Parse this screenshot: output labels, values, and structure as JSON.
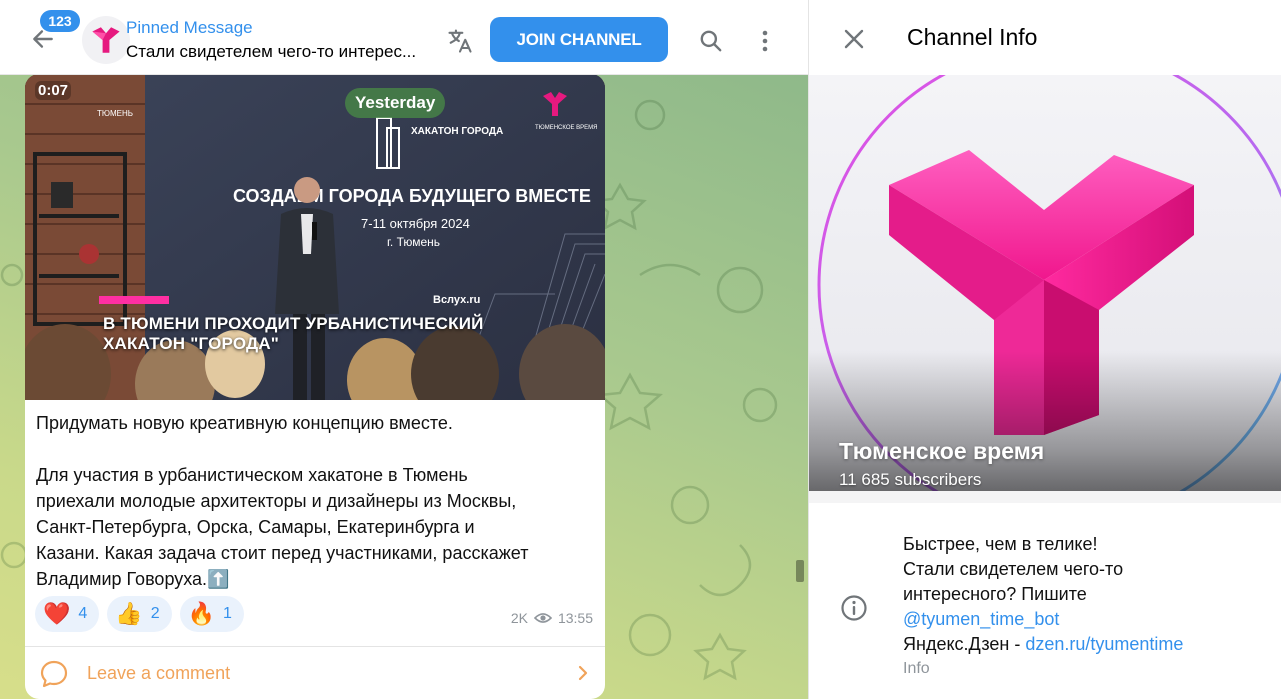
{
  "header": {
    "unread_count": "123",
    "pinned_title": "Pinned Message",
    "pinned_text": "Стали свидетелем чего-то интерес...",
    "join_label": "JOIN CHANNEL"
  },
  "message": {
    "duration": "0:07",
    "date_pill": "Yesterday",
    "media_caption_line1": "В ТЮМЕНИ ПРОХОДИТ УРБАНИСТИЧЕСКИЙ",
    "media_caption_line2": "ХАКАТОН \"ГОРОДА\"",
    "banner": {
      "city": "ТЮМЕНЬ",
      "hackathon": "ХАКАТОН ГОРОДА",
      "headline": "СОЗДАЕМ ГОРОДА БУДУЩЕГО ВМЕСТЕ",
      "dates": "7-11 октября 2024",
      "place": "г. Тюмень",
      "brand": "ТЮМЕНСКОЕ ВРЕМЯ",
      "sponsor": "Вслух.ru"
    },
    "bold_line": "Придумать новую креативную концепцию вместе.",
    "body_lines": [
      "Для участия в урбанистическом хакатоне в Тюмень",
      "приехали молодые архитекторы и дизайнеры из Москвы,",
      "Санкт-Петербурга, Орска, Самары, Екатеринбурга и",
      "Казани. Какая задача стоит перед участниками, расскажет",
      "Владимир Говоруха.⬆️"
    ],
    "reactions": [
      {
        "emoji": "❤️",
        "count": "4"
      },
      {
        "emoji": "👍",
        "count": "2"
      },
      {
        "emoji": "🔥",
        "count": "1"
      }
    ],
    "views": "2K",
    "time": "13:55",
    "comment_label": "Leave a comment"
  },
  "info": {
    "title": "Channel Info",
    "channel_name": "Тюменское время",
    "subscribers": "11 685 subscribers",
    "about_lines": [
      "Быстрее, чем в телике!",
      "Стали свидетелем чего-то",
      "интересного? Пишите"
    ],
    "bot_link": "@tyumen_time_bot",
    "dzen_prefix": "Яндекс.Дзен - ",
    "dzen_link": "dzen.ru/tyumentime",
    "about_label": "Info"
  },
  "colors": {
    "accent": "#3390ec",
    "comment_accent": "#f0a35a",
    "brand_magenta": "#e6197f"
  },
  "icons": [
    "arrow-left-icon",
    "translate-icon",
    "search-icon",
    "more-vertical-icon",
    "close-icon",
    "comment-icon",
    "chevron-right-icon",
    "info-icon",
    "eye-icon"
  ]
}
